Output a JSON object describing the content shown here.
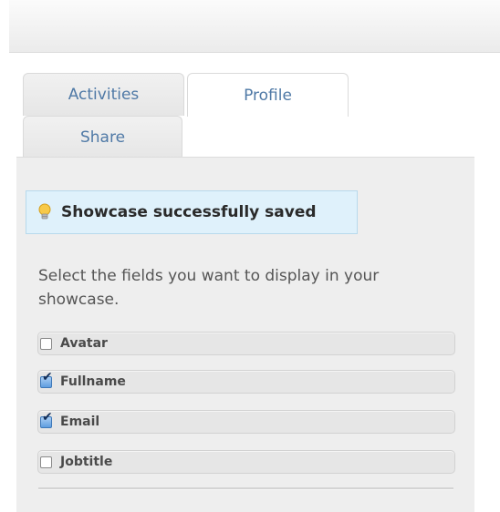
{
  "tabs": {
    "activities": "Activities",
    "profile": "Profile",
    "share": "Share",
    "active": "profile"
  },
  "notice": {
    "icon": "lightbulb-icon",
    "message": "Showcase successfully saved"
  },
  "description": "Select the fields you want to display in your showcase.",
  "fields": [
    {
      "label": "Avatar",
      "checked": false
    },
    {
      "label": "Fullname",
      "checked": true
    },
    {
      "label": "Email",
      "checked": true
    },
    {
      "label": "Jobtitle",
      "checked": false
    }
  ],
  "colors": {
    "tab_text": "#4f79a6",
    "notice_background": "#dff1fb",
    "panel_background": "#eeeeee"
  }
}
